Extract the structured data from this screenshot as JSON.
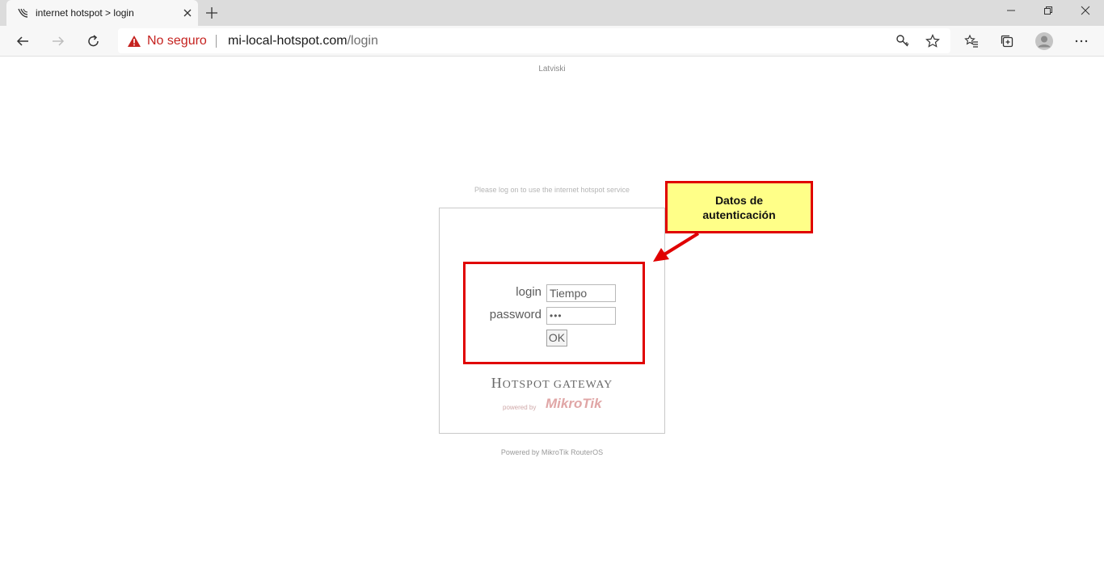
{
  "browser": {
    "tab_title": "internet hotspot > login",
    "security_label": "No seguro",
    "url_host": "mi-local-hotspot.com",
    "url_path": "/login",
    "icons": [
      "back-icon",
      "forward-icon",
      "refresh-icon",
      "warning-icon",
      "key-icon",
      "star-icon",
      "favorites-icon",
      "collections-icon",
      "profile-icon",
      "more-icon",
      "minimize-icon",
      "restore-icon",
      "close-icon",
      "new-tab-icon"
    ]
  },
  "page": {
    "language_link": "Latviski",
    "intro": "Please log on to use the internet hotspot service",
    "form": {
      "login_label": "login",
      "login_value": "Tiempo",
      "password_label": "password",
      "password_value": "•••",
      "submit_label": "OK"
    },
    "gateway_title_first": "H",
    "gateway_title_rest": "OTSPOT GATEWAY",
    "powered_by_small": "powered by",
    "brand_logo": "MikroTik",
    "footer": "Powered by MikroTik RouterOS"
  },
  "annotation": {
    "callout_text": "Datos de autenticación",
    "color": "#e00000",
    "callout_bg": "#ffff88"
  }
}
